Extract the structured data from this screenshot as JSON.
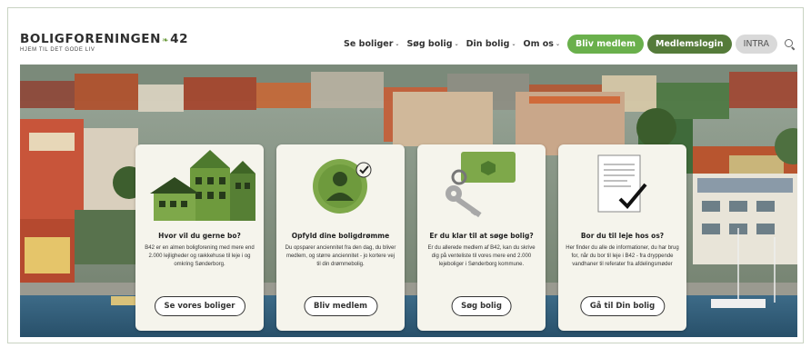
{
  "header": {
    "logo_title": "BOLIGFORENINGEN",
    "logo_number": "42",
    "logo_tagline": "HJEM TIL DET GODE LIV",
    "nav": [
      {
        "label": "Se boliger",
        "chevron": "⌄"
      },
      {
        "label": "Søg bolig",
        "chevron": "⌄"
      },
      {
        "label": "Din bolig",
        "chevron": "⌄"
      },
      {
        "label": "Om os",
        "chevron": "⌄"
      }
    ],
    "buttons": {
      "become_member": "Bliv medlem",
      "member_login": "Medlemslogin",
      "intra": "INTRA"
    },
    "search_icon": "search-icon"
  },
  "colors": {
    "brand_green": "#6ab04c",
    "dark_green": "#557b3a",
    "card_bg": "#f5f4ec"
  },
  "cards": [
    {
      "icon": "houses-icon",
      "title": "Hvor vil du gerne bo?",
      "text": "B42 er en almen boligforening med mere end 2.000 lejligheder og rækkehuse til leje i og omkring Sønderborg.",
      "button": "Se vores boliger"
    },
    {
      "icon": "member-check-icon",
      "title": "Opfyld dine boligdrømme",
      "text": "Du opsparer anciennitet fra den dag, du bliver medlem, og større anciennitet - jo kortere vej til din drømmebolig.",
      "button": "Bliv medlem"
    },
    {
      "icon": "key-icon",
      "title": "Er du klar til at søge bolig?",
      "text": "Er du allerede medlem af B42, kan du skrive dig på venteliste til vores mere end 2.000 lejeboliger i Sønderborg kommune.",
      "button": "Søg bolig"
    },
    {
      "icon": "document-check-icon",
      "title": "Bor du til leje hos os?",
      "text": "Her finder du alle de informationer, du har brug for, når du bor til leje i B42 - fra dryppende vandhaner til referater fra afdelingsmøder",
      "button": "Gå til Din bolig"
    }
  ]
}
